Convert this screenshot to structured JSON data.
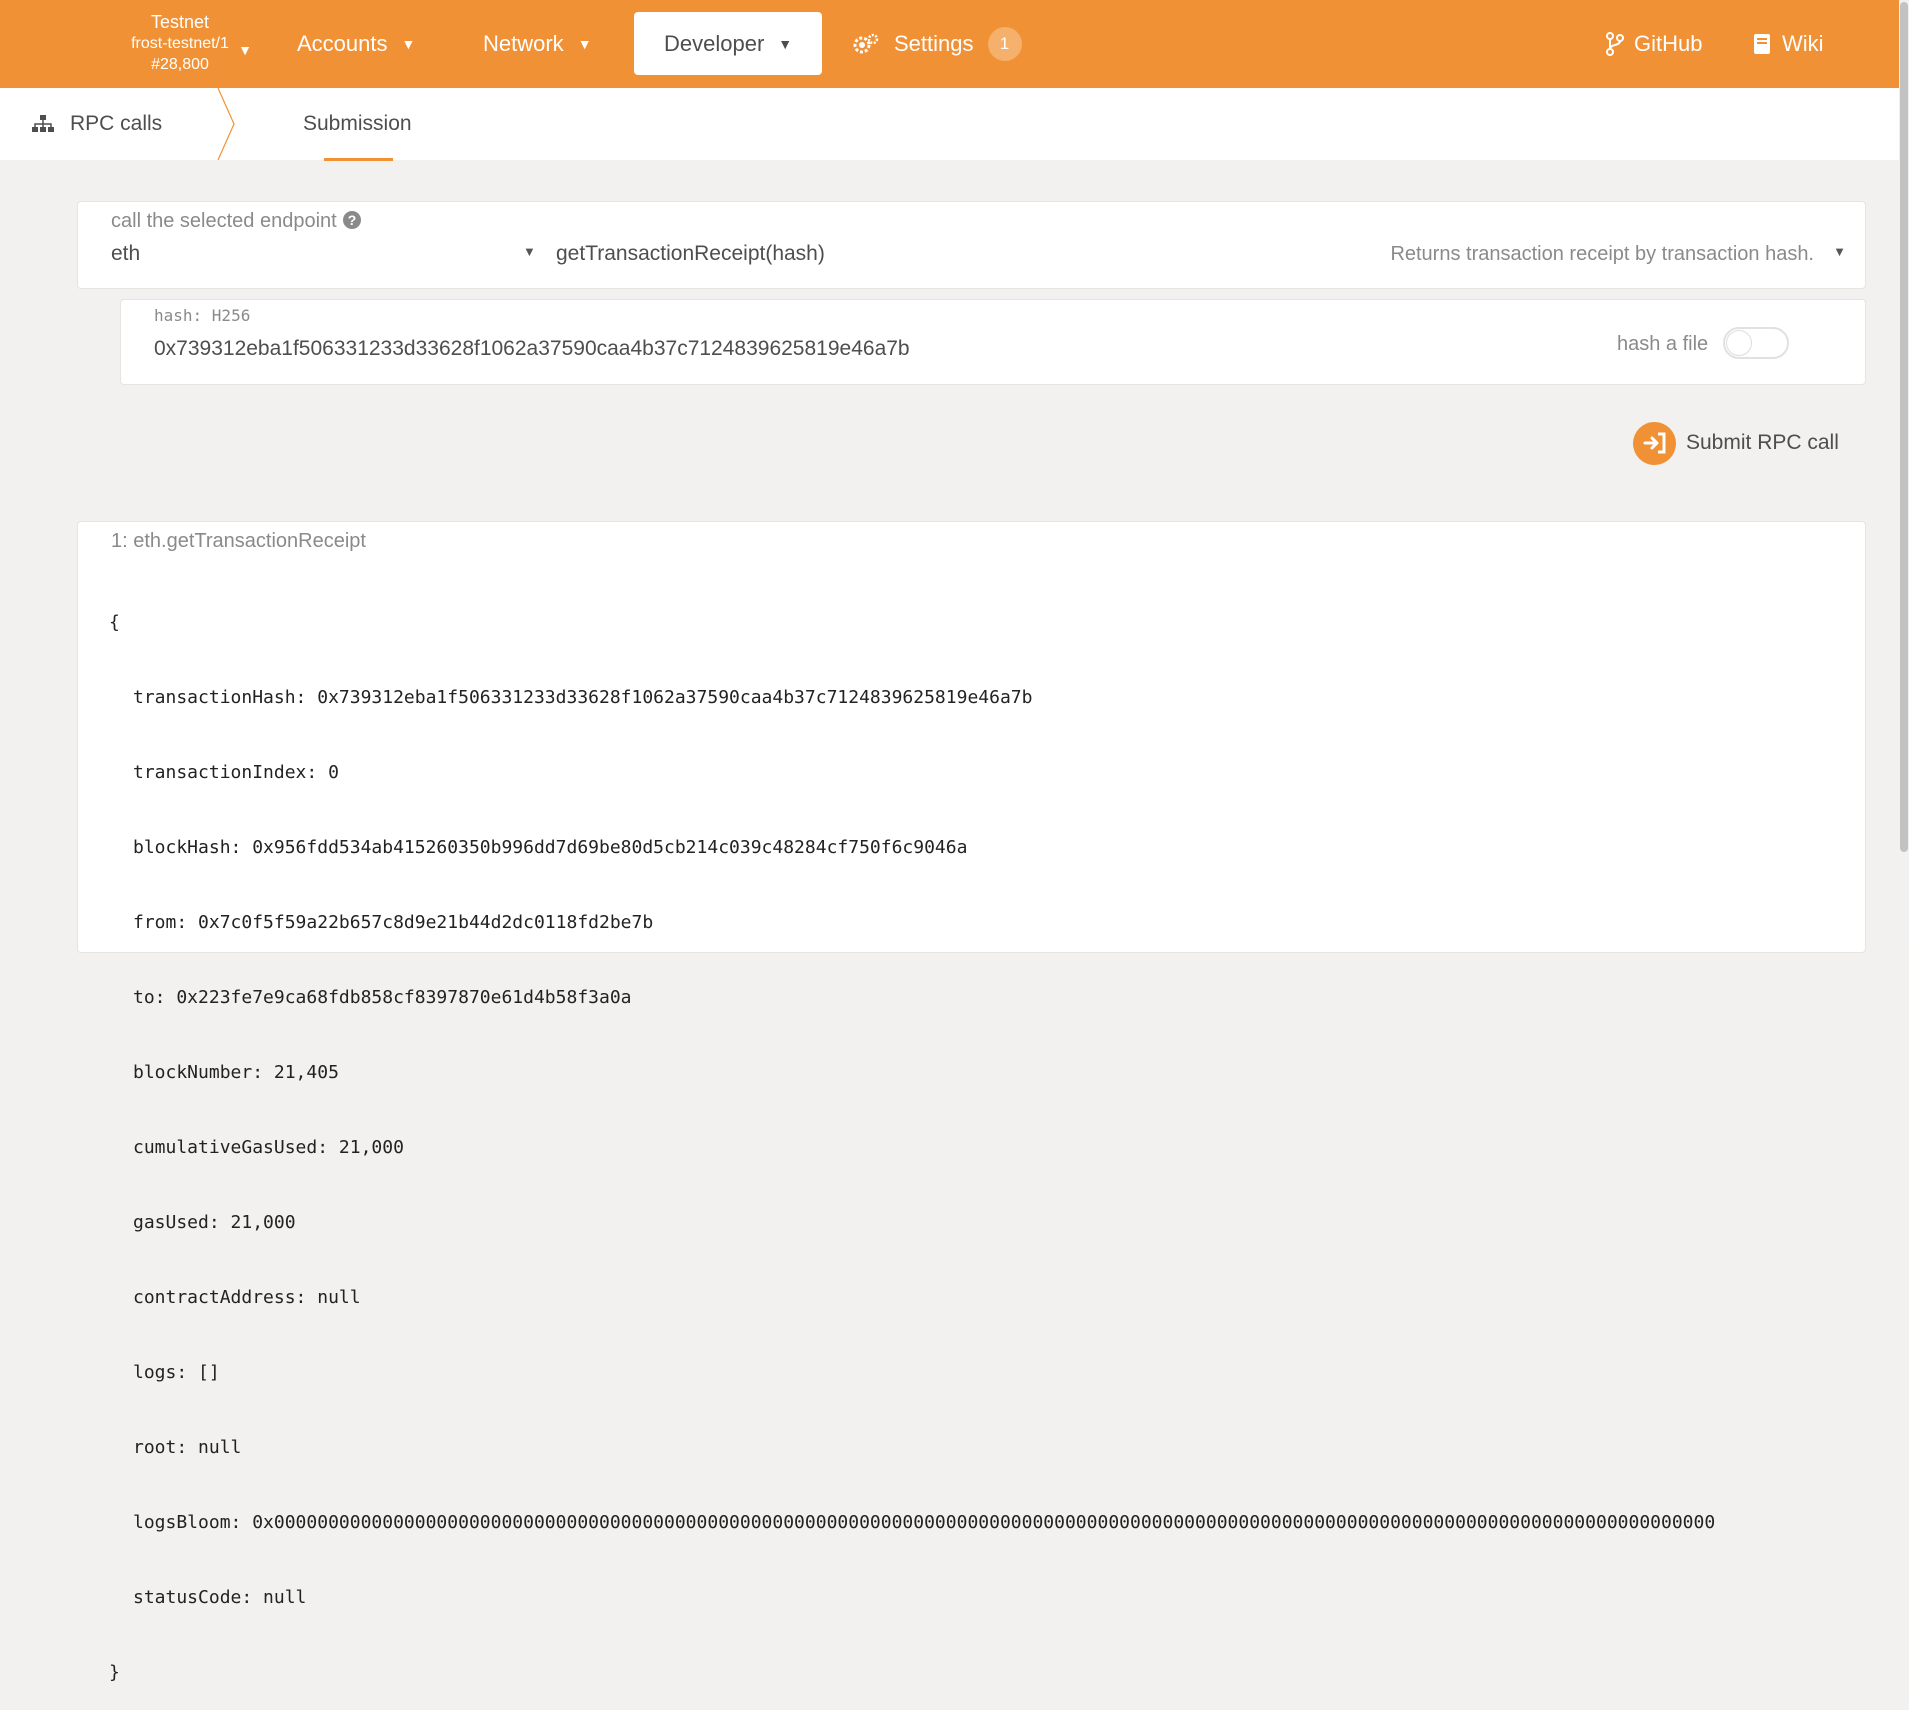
{
  "topbar": {
    "chain": {
      "name": "Testnet",
      "node": "frost-testnet/1",
      "block": "#28,800"
    },
    "nav": {
      "accounts": "Accounts",
      "network": "Network",
      "developer": "Developer",
      "settings": "Settings",
      "settings_badge": "1"
    },
    "links": {
      "github": "GitHub",
      "wiki": "Wiki"
    },
    "color": "#f19135"
  },
  "subbar": {
    "rpc_calls": "RPC calls",
    "submission": "Submission"
  },
  "endpoint": {
    "label": "call the selected endpoint",
    "section": "eth",
    "method": "getTransactionReceipt(hash)",
    "description": "Returns transaction receipt by transaction hash."
  },
  "hash_param": {
    "label": "hash: H256",
    "value": "0x739312eba1f506331233d33628f1062a37590caa4b37c7124839625819e46a7b",
    "hash_file_label": "hash a file"
  },
  "submit_label": "Submit RPC call",
  "result": {
    "title": "1: eth.getTransactionReceipt",
    "open": "{",
    "close": "}",
    "lines": [
      "transactionHash: 0x739312eba1f506331233d33628f1062a37590caa4b37c7124839625819e46a7b",
      "transactionIndex: 0",
      "blockHash: 0x956fdd534ab415260350b996dd7d69be80d5cb214c039c48284cf750f6c9046a",
      "from: 0x7c0f5f59a22b657c8d9e21b44d2dc0118fd2be7b",
      "to: 0x223fe7e9ca68fdb858cf8397870e61d4b58f3a0a",
      "blockNumber: 21,405",
      "cumulativeGasUsed: 21,000",
      "gasUsed: 21,000",
      "contractAddress: null",
      "logs: []",
      "root: null",
      "logsBloom: 0x0000000000000000000000000000000000000000000000000000000000000000000000000000000000000000000000000000000000000000000000000000000000000",
      "statusCode: null"
    ]
  }
}
